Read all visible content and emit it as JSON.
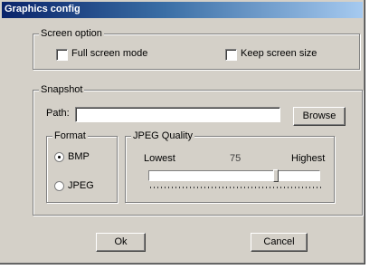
{
  "window": {
    "title": "Graphics config"
  },
  "screen_option": {
    "legend": "Screen option",
    "full_screen_label": "Full screen mode",
    "full_screen_checked": false,
    "keep_size_label": "Keep screen size",
    "keep_size_checked": false
  },
  "snapshot": {
    "legend": "Snapshot",
    "path_label": "Path:",
    "path_value": "",
    "browse_label": "Browse",
    "format": {
      "legend": "Format",
      "options": [
        "BMP",
        "JPEG"
      ],
      "selected": "BMP"
    },
    "jpeg_quality": {
      "legend": "JPEG Quality",
      "lowest_label": "Lowest",
      "value_label": "75",
      "highest_label": "Highest",
      "value": 75,
      "min": 0,
      "max": 100
    }
  },
  "buttons": {
    "ok_label": "Ok",
    "cancel_label": "Cancel"
  },
  "colors": {
    "face": "#d4d0c8",
    "title_start": "#0a246a",
    "title_end": "#a6caf0"
  }
}
